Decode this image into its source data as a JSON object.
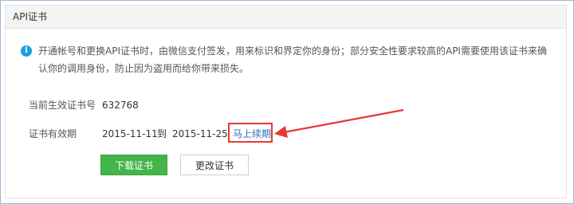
{
  "panel": {
    "title": "API证书"
  },
  "notice": {
    "icon": "info-icon",
    "text": "开通帐号和更换API证书时，由微信支付签发，用来标识和界定你的身份；部分安全性要求较高的API需要使用该证书来确认你的调用身份，防止因为盗用而给你带来损失。"
  },
  "cert": {
    "label": "当前生效证书号",
    "number": "632768"
  },
  "validity": {
    "label": "证书有效期",
    "from": "2015-11-11",
    "to_word": "到",
    "to": "2015-11-25",
    "renew_label": "马上续期"
  },
  "actions": {
    "download_label": "下载证书",
    "change_label": "更改证书"
  },
  "colors": {
    "primary_button": "#44b549",
    "link": "#2a6fb7",
    "annotation": "#e53935",
    "info_icon": "#1e9be4"
  }
}
